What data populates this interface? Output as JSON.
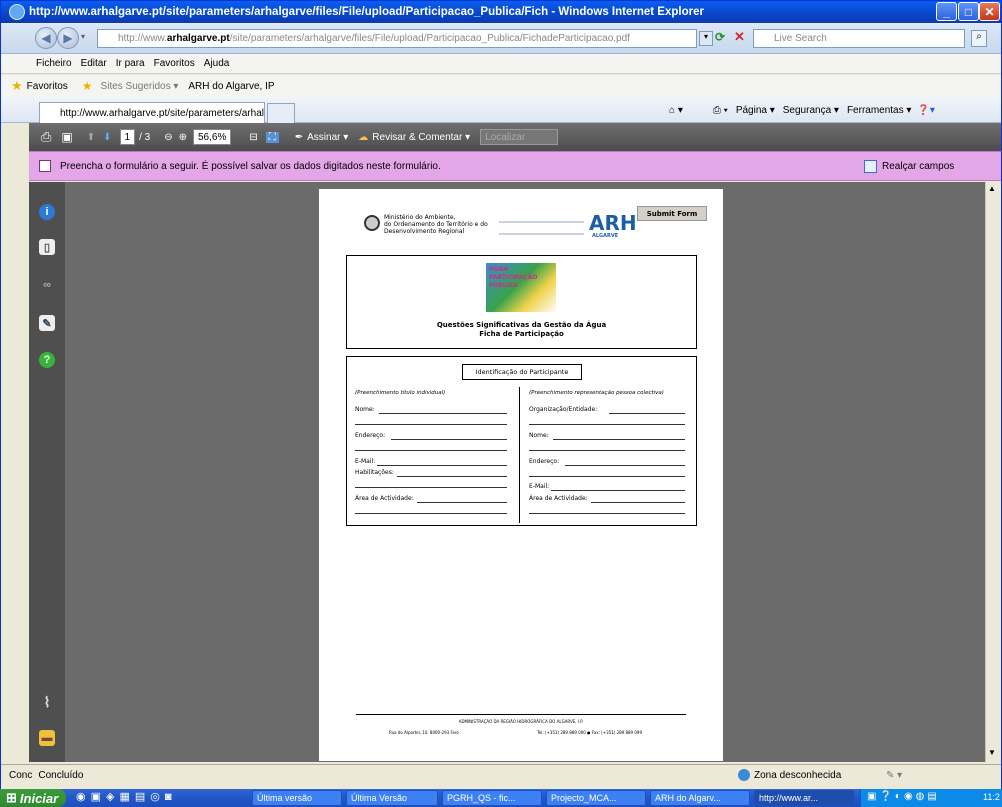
{
  "window": {
    "title": "http://www.arhalgarve.pt/site/parameters/arhalgarve/files/File/upload/Participacao_Publica/Fich - Windows Internet Explorer",
    "address_prefix": "http://www.",
    "address_domain": "arhalgarve.pt",
    "address_rest": "/site/parameters/arhalgarve/files/File/upload/Participacao_Publica/FichadeParticipacao.pdf",
    "search_placeholder": "Live Search"
  },
  "menu": [
    "Ficheiro",
    "Editar",
    "Ir para",
    "Favoritos",
    "Ajuda"
  ],
  "favorites": {
    "label": "Favoritos",
    "items": [
      "Sites Sugeridos ▾",
      "ARH do Algarve, IP"
    ]
  },
  "tab": {
    "title": "http://www.arhalgarve.pt/site/parameters/arhalgarv..."
  },
  "command_bar": [
    "Página ▾",
    "Segurança ▾",
    "Ferramentas ▾"
  ],
  "pdf_toolbar": {
    "page_current": "1",
    "page_total": "/ 3",
    "zoom": "56,6%",
    "sign": "Assinar ▾",
    "review": "Revisar & Comentar ▾",
    "find_placeholder": "Localizar"
  },
  "notice": {
    "text": "Preencha o formulário a seguir. É possível salvar os dados digitados neste formulário.",
    "highlight": "Realçar campos"
  },
  "document": {
    "ministry": [
      "Ministério do Ambiente,",
      "do Ordenamento do Território e do",
      "Desenvolvimento Regional"
    ],
    "arh_logo": "ARH",
    "arh_sub": "ALGARVE",
    "submit": "Submit Form",
    "pgrh_logo": [
      "PGRH",
      "PARTICIPAÇÃO",
      "PÚBLICA"
    ],
    "title1": "Questões Significativas da Gestão da Água",
    "title2": "Ficha de Participação",
    "section": "Identificação do Participante",
    "left_heading": "(Preenchimento título individual)",
    "left_fields": [
      "Nome:",
      "Endereço:",
      "E-Mail:",
      "Habilitações:",
      "Área de Actividade:"
    ],
    "right_heading": "(Preenchimento representação pessoa colectiva)",
    "right_fields": [
      "Organização/Entidade:",
      "Nome:",
      "Endereço:",
      "E-Mail:",
      "Área de Actividade:"
    ],
    "footer1": "ADMINISTRAÇÃO DA REGIÃO HIDROGRÁFICA DO ALGARVE, I.P.",
    "footer2a": "Rua do Alportel, 10, 8000-293 Faro",
    "footer2b": "Tel: (+351) 289 889 000 ● Fax: (+351) 289 889 099"
  },
  "status": {
    "left_cut": "Conc",
    "text": "Concluído",
    "zone": "Zona desconhecida",
    "zoom": "✎ ▾"
  },
  "taskbar": {
    "start": "Iniciar",
    "tasks": [
      "Última versão",
      "Última Versão",
      "PGRH_QS - fic...",
      "Projecto_MCA...",
      "ARH do Algarv...",
      "http://www.ar..."
    ],
    "clock": "11:2"
  },
  "colors": {
    "title_blue": "#0846c8",
    "notice_bg": "#e3a6e6",
    "viewer_bg": "#6b6b6b",
    "start_green": "#3c9a3c"
  }
}
